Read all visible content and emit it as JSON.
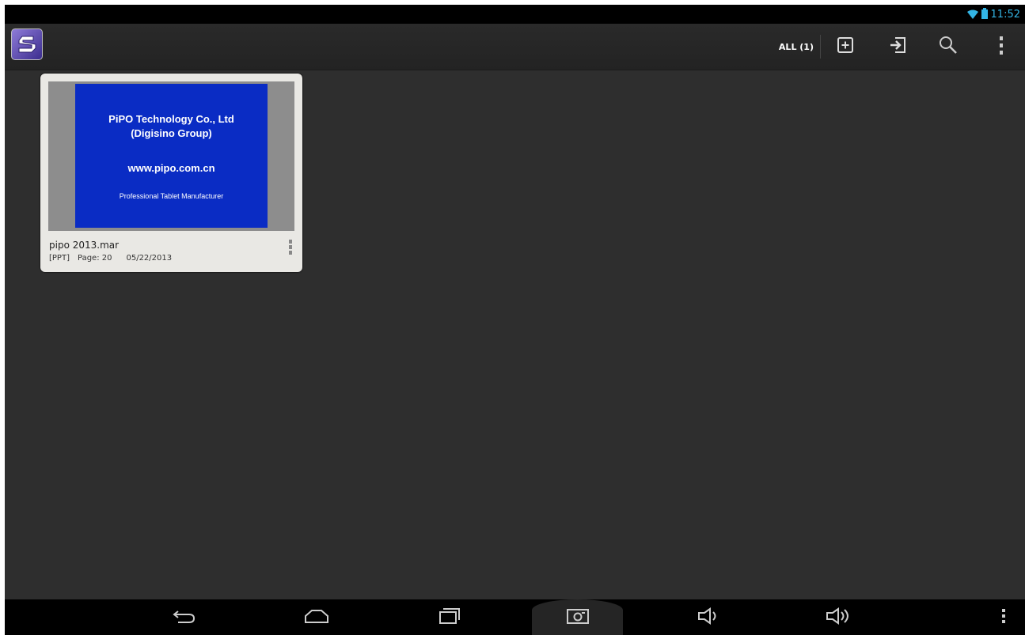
{
  "status_bar": {
    "time": "11:52",
    "wifi_icon": "wifi-icon",
    "battery_icon": "battery-icon"
  },
  "action_bar": {
    "app_icon": "app-logo-icon",
    "filter_label": "ALL (1)",
    "buttons": [
      "new-document-icon",
      "import-icon",
      "search-icon",
      "overflow-menu-icon"
    ]
  },
  "documents": [
    {
      "title": "pipo 2013.mar",
      "type": "[PPT]",
      "pages": "Page: 20",
      "date": "05/22/2013",
      "slide": {
        "line1": "PiPO Technology Co., Ltd",
        "line2": "(Digisino Group)",
        "url": "www.pipo.com.cn",
        "tagline": "Professional Tablet Manufacturer"
      }
    }
  ],
  "nav_bar": {
    "buttons": [
      "back-icon",
      "home-icon",
      "recent-apps-icon",
      "screenshot-icon",
      "volume-down-icon",
      "volume-up-icon",
      "menu-icon"
    ]
  },
  "colors": {
    "status_time": "#33b5e5",
    "slide_background": "#0a2cc4",
    "card_background": "#e9e8e4",
    "content_background": "#2e2e2e"
  }
}
